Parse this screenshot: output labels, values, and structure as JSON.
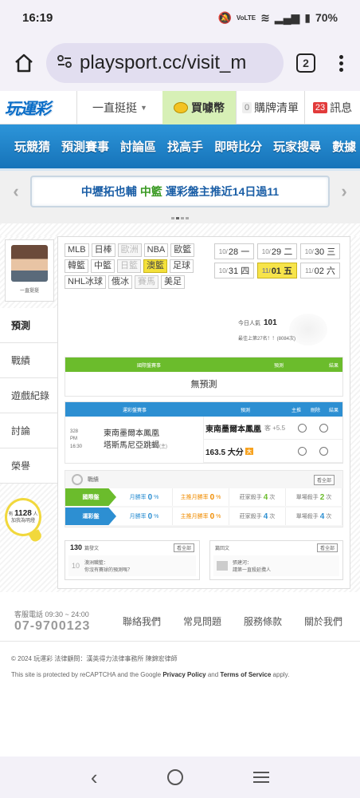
{
  "status": {
    "time": "16:19",
    "battery": "70%",
    "signal_label": "VoLTE"
  },
  "browser": {
    "url": "playsport.cc/visit_m",
    "tab_count": "2"
  },
  "header": {
    "logo": "玩運彩",
    "dropdown_label": "一直挺挺",
    "buy_coin_label": "買噱幣",
    "cart_count": "0",
    "cart_label": "購牌清單",
    "msg_count": "23",
    "msg_label": "訊息"
  },
  "nav": {
    "items": [
      "玩競猜",
      "預測賽事",
      "討論區",
      "找高手",
      "即時比分",
      "玩家搜尋",
      "數據"
    ]
  },
  "marquee": {
    "team": "中壢拓也輔",
    "league": "中籃",
    "text": "運彩盤主推近14日過11"
  },
  "profile": {
    "name": "一直挺挺"
  },
  "sidemenu": {
    "items": [
      "預測",
      "戰績",
      "遊戲紀錄",
      "討論",
      "榮譽"
    ]
  },
  "bulb": {
    "prefix": "有",
    "count": "1128",
    "suffix": "人",
    "line2": "加我為明燈"
  },
  "leagues": [
    {
      "label": "MLB",
      "state": "normal"
    },
    {
      "label": "日棒",
      "state": "normal"
    },
    {
      "label": "歐洲",
      "state": "dim"
    },
    {
      "label": "NBA",
      "state": "normal"
    },
    {
      "label": "歐籃",
      "state": "normal"
    },
    {
      "label": "韓籃",
      "state": "normal"
    },
    {
      "label": "中籃",
      "state": "normal"
    },
    {
      "label": "日籃",
      "state": "dim"
    },
    {
      "label": "澳籃",
      "state": "hl"
    },
    {
      "label": "足球",
      "state": "normal"
    },
    {
      "label": "NHL冰球",
      "state": "normal"
    },
    {
      "label": "俄冰",
      "state": "normal"
    },
    {
      "label": "賽馬",
      "state": "dim"
    },
    {
      "label": "美足",
      "state": "normal"
    }
  ],
  "dates": [
    {
      "prefix": "10/",
      "label": "28 一",
      "sel": false
    },
    {
      "prefix": "10/",
      "label": "29 二",
      "sel": false
    },
    {
      "prefix": "10/",
      "label": "30 三",
      "sel": false
    },
    {
      "prefix": "10/",
      "label": "31 四",
      "sel": false
    },
    {
      "prefix": "11/",
      "label": "01 五",
      "sel": true
    },
    {
      "prefix": "11/",
      "label": "02 六",
      "sel": false
    }
  ],
  "popularity": {
    "label": "今日人氣",
    "value": "101",
    "history": "最佳上第27名！！(8084次)"
  },
  "table1": {
    "headers": [
      "國際盤賽事",
      "預測",
      "結果"
    ],
    "empty_text": "無預測"
  },
  "table2": {
    "headers": [
      "運彩盤賽事",
      "預測",
      "主推",
      "刪除",
      "結果"
    ],
    "game_no": "328",
    "game_time": "PM 16:30",
    "team_a": "東南墨爾本鳳凰",
    "team_b": "塔斯馬尼亞跳蝎",
    "team_b_mark": "(主)",
    "pred1": "東南墨爾本鳳凰",
    "pred1_extra": "客 +5.5",
    "pred2": "163.5 大分",
    "pred2_tag": "大"
  },
  "record": {
    "title": "戰績",
    "more": "看全部",
    "rows": [
      {
        "label": "國際盤",
        "month_rate_label": "月勝率",
        "month_rate": "0",
        "main_rate_label": "主推月勝率",
        "main_rate": "0",
        "streak_label": "莊家殺手",
        "streak": "4",
        "single_label": "單場殺手",
        "single": "2"
      },
      {
        "label": "運彩盤",
        "month_rate_label": "月勝率",
        "month_rate": "0",
        "main_rate_label": "主推月勝率",
        "main_rate": "0",
        "streak_label": "莊家殺手",
        "streak": "4",
        "single_label": "單場殺手",
        "single": "4"
      }
    ]
  },
  "posts": {
    "count": "130",
    "label": "篇發文",
    "more": "看全部",
    "item_num": "10",
    "item_title": "澳洲職籃：",
    "item_sub": "你沒有賽球的預測嗎？"
  },
  "posts2": {
    "label": "篇回文",
    "more": "看全部",
    "item_title": "張建河：",
    "item_sub": "請第一直殺延攬人"
  },
  "footer": {
    "hotline_label": "客服電話 09:30 ~ 24:00",
    "hotline": "07-9700123",
    "links": [
      "聯絡我們",
      "常見問題",
      "服務條款",
      "關於我們"
    ],
    "copyright": "© 2024 玩運彩 法律顧問：漢英得力法律事務所 陳錦宏律師",
    "recaptcha_pre": "This site is protected by reCAPTCHA and the Google",
    "privacy": "Privacy Policy",
    "and": "and",
    "terms": "Terms of Service",
    "apply": "apply."
  }
}
